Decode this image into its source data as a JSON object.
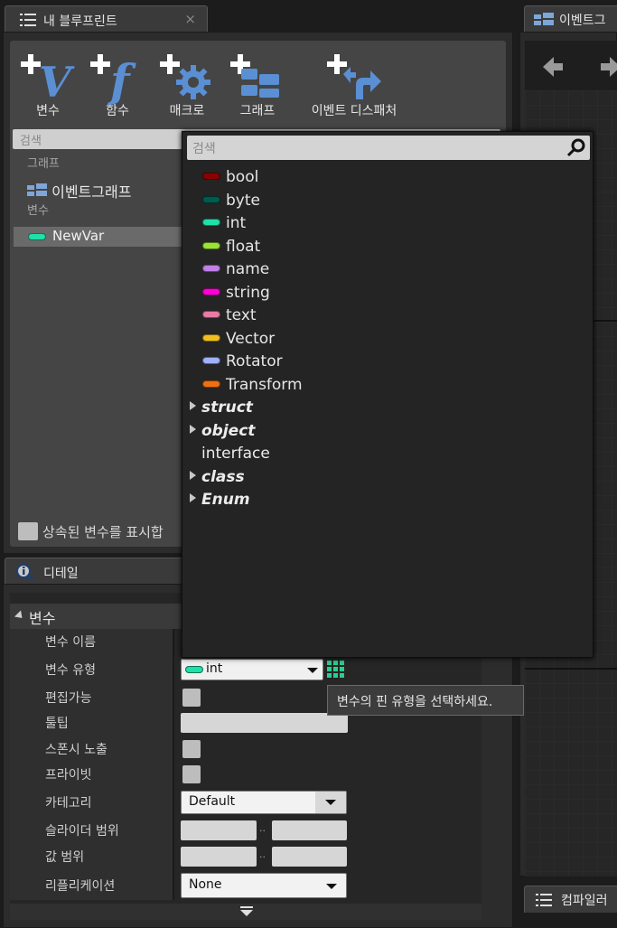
{
  "my_blueprint": {
    "tab_title": "내 블루프린트",
    "close_glyph": "×",
    "toolbar": [
      {
        "label": "변수",
        "icon": "add-variable-icon"
      },
      {
        "label": "함수",
        "icon": "add-function-icon"
      },
      {
        "label": "매크로",
        "icon": "add-macro-icon"
      },
      {
        "label": "그래프",
        "icon": "add-graph-icon"
      },
      {
        "label": "이벤트 디스패처",
        "icon": "add-event-dispatcher-icon"
      }
    ],
    "search_placeholder": "검색",
    "section_graph": "그래프",
    "event_graph": "이벤트그래프",
    "section_variables": "변수",
    "variable_name": "NewVar",
    "show_inherited": "상속된 변수를 표시합"
  },
  "event_graph_tab": {
    "title": "이벤트그",
    "compiler_title": "컴파일러"
  },
  "type_picker": {
    "search_placeholder": "검색",
    "types": [
      {
        "label": "bool",
        "color": "#8b0000"
      },
      {
        "label": "byte",
        "color": "#005b4f"
      },
      {
        "label": "int",
        "color": "#1fe0a9"
      },
      {
        "label": "float",
        "color": "#9be136"
      },
      {
        "label": "name",
        "color": "#c080e8"
      },
      {
        "label": "string",
        "color": "#ff00d4"
      },
      {
        "label": "text",
        "color": "#e87aa6"
      },
      {
        "label": "Vector",
        "color": "#f0c020"
      },
      {
        "label": "Rotator",
        "color": "#9fb0ff"
      },
      {
        "label": "Transform",
        "color": "#f07010"
      }
    ],
    "categories": [
      {
        "label": "struct",
        "expandable": true,
        "style": "bold-italic"
      },
      {
        "label": "object",
        "expandable": true,
        "style": "bold-italic"
      },
      {
        "label": "interface",
        "expandable": false,
        "style": "plain"
      },
      {
        "label": "class",
        "expandable": true,
        "style": "bold-italic"
      },
      {
        "label": "Enum",
        "expandable": true,
        "style": "bold-italic"
      }
    ]
  },
  "details": {
    "tab_title": "디테일",
    "section": "변수",
    "rows": {
      "name_label": "변수 이름",
      "type_label": "변수 유형",
      "type_value": "int",
      "editable_label": "편집가능",
      "tooltip_label": "툴팁",
      "expose_label": "스폰시 노출",
      "private_label": "프라이빗",
      "category_label": "카테고리",
      "category_value": "Default",
      "slider_label": "슬라이더 범위",
      "value_range_label": "값 범위",
      "range_sep": "..",
      "replication_label": "리플리케이션",
      "replication_value": "None"
    },
    "tooltip_text": "변수의 핀 유형을 선택하세요."
  }
}
